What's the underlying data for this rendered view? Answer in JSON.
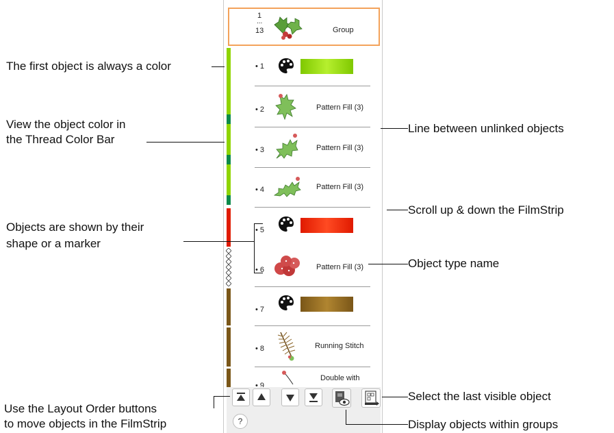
{
  "group": {
    "num_top": "1",
    "num_mid": "...",
    "num_bot": "13",
    "label": "Group"
  },
  "items": [
    {
      "num": "• 1",
      "type": "color",
      "color": "#8fd400",
      "color2": "#b4ee2b"
    },
    {
      "num": "• 2",
      "type": "object",
      "label": "Pattern Fill (3)",
      "shape": "holly-leaf"
    },
    {
      "num": "• 3",
      "type": "object",
      "label": "Pattern Fill (3)",
      "shape": "holly-leaf"
    },
    {
      "num": "• 4",
      "type": "object",
      "label": "Pattern Fill (3)",
      "shape": "holly-leaf"
    },
    {
      "num": "• 5",
      "type": "color",
      "color": "#e01a00",
      "color2": "#ff3a14"
    },
    {
      "num": "• 6",
      "type": "object",
      "label": "Pattern Fill (3)",
      "shape": "berries"
    },
    {
      "num": "• 7",
      "type": "color",
      "color": "#7a5618",
      "color2": "#a77c2e"
    },
    {
      "num": "• 8",
      "type": "object",
      "label": "Running Stitch",
      "shape": "pine-branch"
    },
    {
      "num": "• 9",
      "type": "object",
      "label": "Double with",
      "shape": "stem"
    }
  ],
  "callouts": {
    "first_object": "The first object is always a color",
    "view_color_1": "View the object color in",
    "view_color_2": "the Thread Color Bar",
    "objects_shown_1": "Objects are shown by their",
    "objects_shown_2": "shape or a marker",
    "layout_order_1": "Use the Layout Order buttons",
    "layout_order_2": "to move objects in the FilmStrip",
    "line_between": "Line between unlinked objects",
    "scroll": "Scroll up & down the FilmStrip",
    "object_type": "Object type name",
    "select_last": "Select the last visible object",
    "display_groups": "Display objects within groups"
  },
  "toolbar": {
    "buttons": [
      "move-to-first-icon",
      "move-up-icon",
      "move-down-icon",
      "move-to-last-icon",
      "show-in-groups-icon",
      "select-last-visible-icon"
    ],
    "help_label": "?"
  },
  "colors": {
    "accent": "#f3a25a",
    "lime": "#8fd400",
    "green_dark": "#0c8a4a",
    "red": "#e01a00",
    "brown": "#7a5618"
  }
}
